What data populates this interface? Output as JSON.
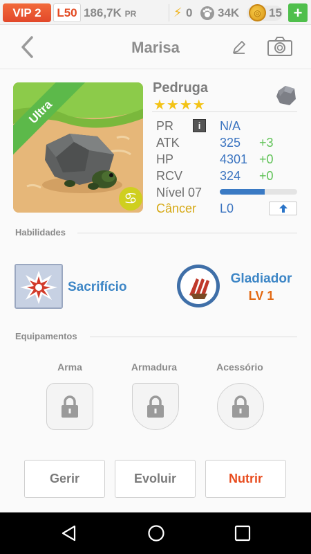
{
  "status": {
    "vip": "VIP 2",
    "level": "L50",
    "power": "186,7K",
    "power_unit": "PR",
    "energy_icon": "lightning-icon",
    "energy": "0",
    "paw_icon": "paw-icon",
    "paws": "34K",
    "coin_icon": "coin-icon",
    "coins": "15",
    "plus": "+"
  },
  "header": {
    "title": "Marisa",
    "back_icon": "chevron-left-icon",
    "edit_icon": "pencil-icon",
    "camera_icon": "camera-icon"
  },
  "pet": {
    "rarity": "Ultra",
    "name": "Pedruga",
    "stars": "★★★★",
    "star_count": 4,
    "element_icon": "rock-icon",
    "zodiac_icon": "cancer-sign-icon",
    "zodiac_glyph": "♋",
    "stats": [
      {
        "label": "PR",
        "value": "N/A",
        "bonus": ""
      },
      {
        "label": "ATK",
        "value": "325",
        "bonus": "+3"
      },
      {
        "label": "HP",
        "value": "4301",
        "bonus": "+0"
      },
      {
        "label": "RCV",
        "value": "324",
        "bonus": "+0"
      }
    ],
    "level_label": "Nível 07",
    "xp_fraction": 0.58,
    "sign_label": "Câncer",
    "sign_level": "L0"
  },
  "abilities": {
    "title": "Habilidades",
    "skill_name": "Sacrifício",
    "skill_icon": "explosion-icon",
    "passive_name": "Gladiador",
    "passive_level": "LV 1",
    "passive_icon": "claw-shield-icon"
  },
  "equipment": {
    "title": "Equipamentos",
    "slots": [
      {
        "label": "Arma",
        "icon": "lock-icon"
      },
      {
        "label": "Armadura",
        "icon": "lock-icon"
      },
      {
        "label": "Acessório",
        "icon": "lock-icon"
      }
    ]
  },
  "actions": {
    "manage": "Gerir",
    "evolve": "Evoluir",
    "feed": "Nutrir",
    "feed_color": "#e84c1e"
  },
  "colors": {
    "accent_blue": "#3d86c6",
    "bonus_green": "#5fc256",
    "vip_orange": "#e2482a",
    "ribbon_green": "#5cb94a"
  }
}
